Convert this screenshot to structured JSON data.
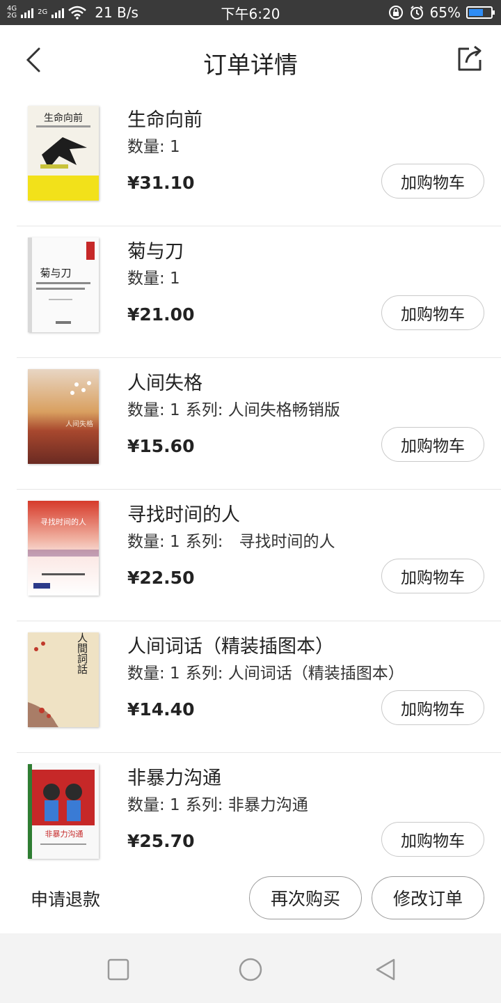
{
  "status_bar": {
    "network_top": "4G",
    "network_bottom": "2G",
    "network2": "2G",
    "speed": "21 B/s",
    "time": "下午6:20",
    "battery": "65%",
    "battery_level": 0.65,
    "battery_color": "#2f8df5"
  },
  "header": {
    "title": "订单详情",
    "back_icon": "chevron-left-icon",
    "share_icon": "share-icon"
  },
  "items": [
    {
      "title": "生命向前",
      "qty_label": "数量: 1",
      "series": "",
      "price": "¥31.10",
      "cart_label": "加购物车"
    },
    {
      "title": "菊与刀",
      "qty_label": "数量: 1",
      "series": "",
      "price": "¥21.00",
      "cart_label": "加购物车"
    },
    {
      "title": "人间失格",
      "qty_label": "数量: 1",
      "series": "系列: 人间失格畅销版",
      "price": "¥15.60",
      "cart_label": "加购物车"
    },
    {
      "title": "寻找时间的人",
      "qty_label": "数量: 1",
      "series": "系列:　寻找时间的人",
      "price": "¥22.50",
      "cart_label": "加购物车"
    },
    {
      "title": "人间词话（精装插图本）",
      "qty_label": "数量: 1",
      "series": "系列: 人间词话（精装插图本）",
      "price": "¥14.40",
      "cart_label": "加购物车"
    },
    {
      "title": "非暴力沟通",
      "qty_label": "数量: 1",
      "series": "系列: 非暴力沟通",
      "price": "¥25.70",
      "cart_label": "加购物车"
    }
  ],
  "covers": [
    {
      "text": "生命向前"
    },
    {
      "text": "菊与刀"
    },
    {
      "text": "人间失格"
    },
    {
      "text": "寻找时间的人"
    },
    {
      "text": "人間詞話"
    },
    {
      "text": "非暴力沟通"
    }
  ],
  "actions": {
    "refund": "申请退款",
    "rebuy": "再次购买",
    "modify": "修改订单"
  },
  "nav": {
    "recent_icon": "square-recent-apps-icon",
    "home_icon": "circle-home-icon",
    "back_icon": "triangle-back-icon"
  }
}
